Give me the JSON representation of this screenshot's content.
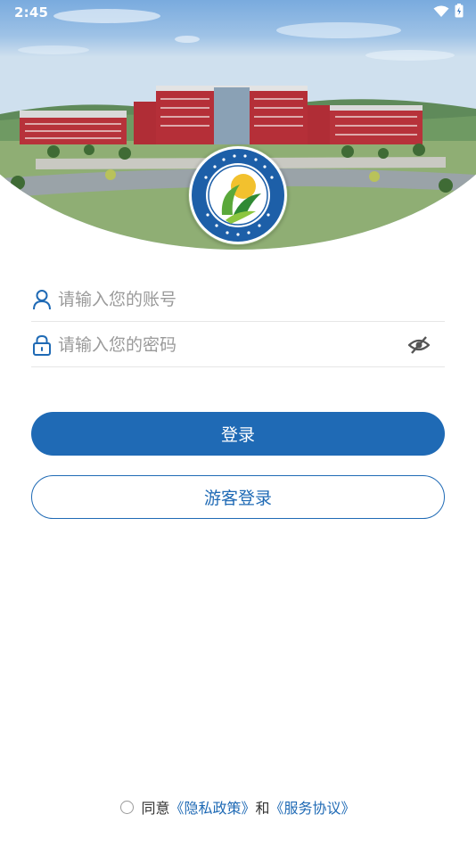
{
  "status_bar": {
    "time": "2:45",
    "icons": [
      "wifi-icon",
      "battery-icon"
    ]
  },
  "header": {
    "image": "campus-building-photo",
    "logo": "college-emblem"
  },
  "form": {
    "username": {
      "placeholder": "请输入您的账号",
      "value": "",
      "icon": "user-icon"
    },
    "password": {
      "placeholder": "请输入您的密码",
      "value": "",
      "icon": "lock-icon",
      "toggle_icon": "eye-off-icon"
    }
  },
  "buttons": {
    "login_label": "登录",
    "guest_label": "游客登录"
  },
  "agreement": {
    "prefix": "同意",
    "privacy_link": "《隐私政策》",
    "conjunction": "和",
    "service_link": "《服务协议》",
    "checked": false
  },
  "colors": {
    "primary": "#1f6ab5",
    "placeholder": "#9a9a9a",
    "divider": "#e6e6e6"
  }
}
